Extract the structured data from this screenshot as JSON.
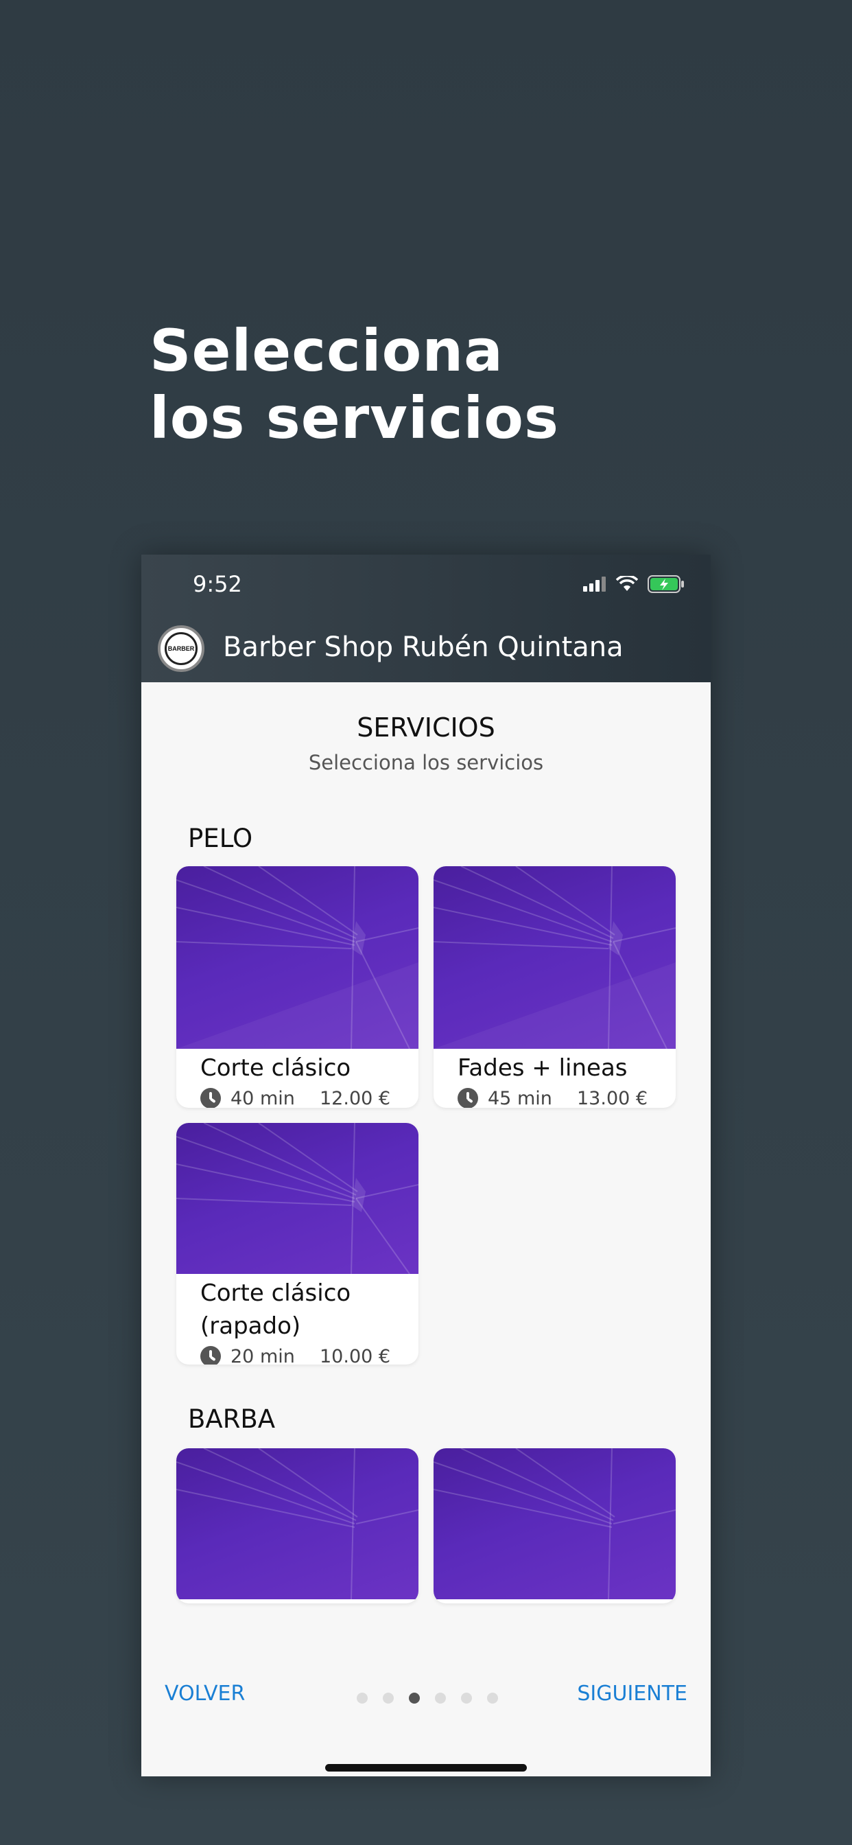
{
  "headline": {
    "line1": "Selecciona",
    "line2": "los servicios"
  },
  "status_bar": {
    "time": "9:52",
    "icons": [
      "signal-icon",
      "wifi-icon",
      "battery-charging-icon"
    ],
    "battery_color": "#35c759"
  },
  "app_bar": {
    "shop_name": "Barber Shop Rubén Quintana",
    "logo_text": "BARBER"
  },
  "services_header": {
    "title": "SERVICIOS",
    "subtitle": "Selecciona los servicios"
  },
  "categories": [
    {
      "name": "PELO",
      "services": [
        {
          "title": "Corte clásico",
          "duration": "40 min",
          "price": "12.00 €"
        },
        {
          "title": "Fades + lineas",
          "duration": "45 min",
          "price": "13.00 €"
        },
        {
          "title": "Corte clásico (rapado)",
          "duration": "20 min",
          "price": "10.00 €"
        }
      ]
    },
    {
      "name": "BARBA",
      "services": []
    }
  ],
  "footer": {
    "back_label": "VOLVER",
    "next_label": "SIGUIENTE",
    "pager": {
      "total": 6,
      "current": 3
    }
  },
  "colors": {
    "accent": "#1a7fd4",
    "card_image": "#5a2aba",
    "background": "#323f47"
  }
}
